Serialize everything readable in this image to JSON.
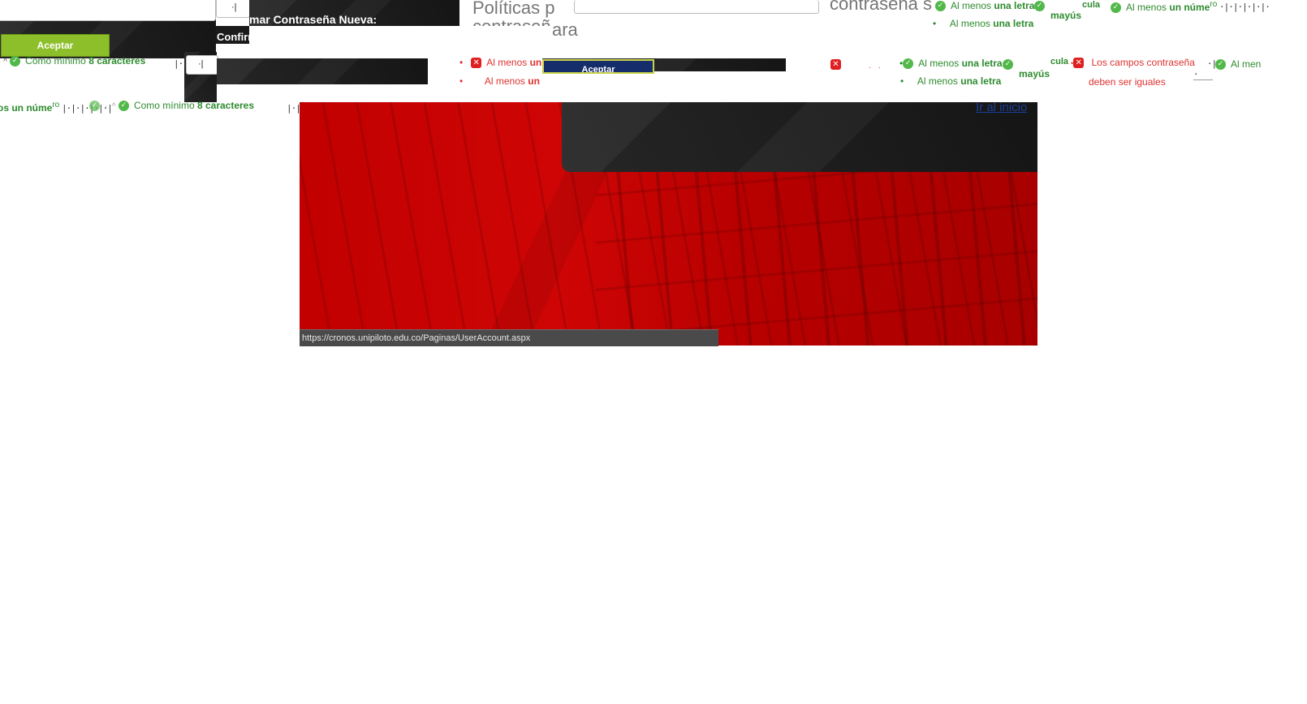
{
  "form": {
    "accept_label": "Aceptar",
    "confirm_label_fragment": "mar Contraseña Nueva:",
    "confirm_label_fragment2": "Confirm",
    "policies_title": "Políticas p",
    "policies_title2": "contraseñ",
    "fragment_ara": "ara",
    "fragment_contrasena_s": "contraseña s",
    "return_link": "Ir al inicio"
  },
  "rules": {
    "min_chars_prefix": "Como mínimo ",
    "min_chars_bold": "8 caracteres",
    "uppercase_prefix": "Al menos ",
    "uppercase_bold": "una letra",
    "uppercase_suffix": "mayús",
    "uppercase_suffix2": "cula",
    "number_prefix": "Al menos ",
    "number_bold": "un núme",
    "number_suffix": "ro",
    "number_left_fragment": "os un núme",
    "lowercase_prefix": "Al menos ",
    "lowercase_bold": "una letra",
    "error_prefix": "Al menos ",
    "error_bold": "un",
    "match_error_1": "Los campos contraseña",
    "match_error_2": "deben ser iguales",
    "al_menos": "Al men",
    "al_menos2": "os",
    "icon_ok": "check-circle-icon",
    "icon_err": "x-square-icon"
  },
  "browser": {
    "status_url": "https://cronos.unipiloto.edu.co/Paginas/UserAccount.aspx"
  },
  "colors": {
    "accent_green": "#8dbf2a",
    "ok_text": "#2e8b2e",
    "error_text": "#e03131",
    "banner_red": "#c10000",
    "navy_button": "#152d6b"
  }
}
